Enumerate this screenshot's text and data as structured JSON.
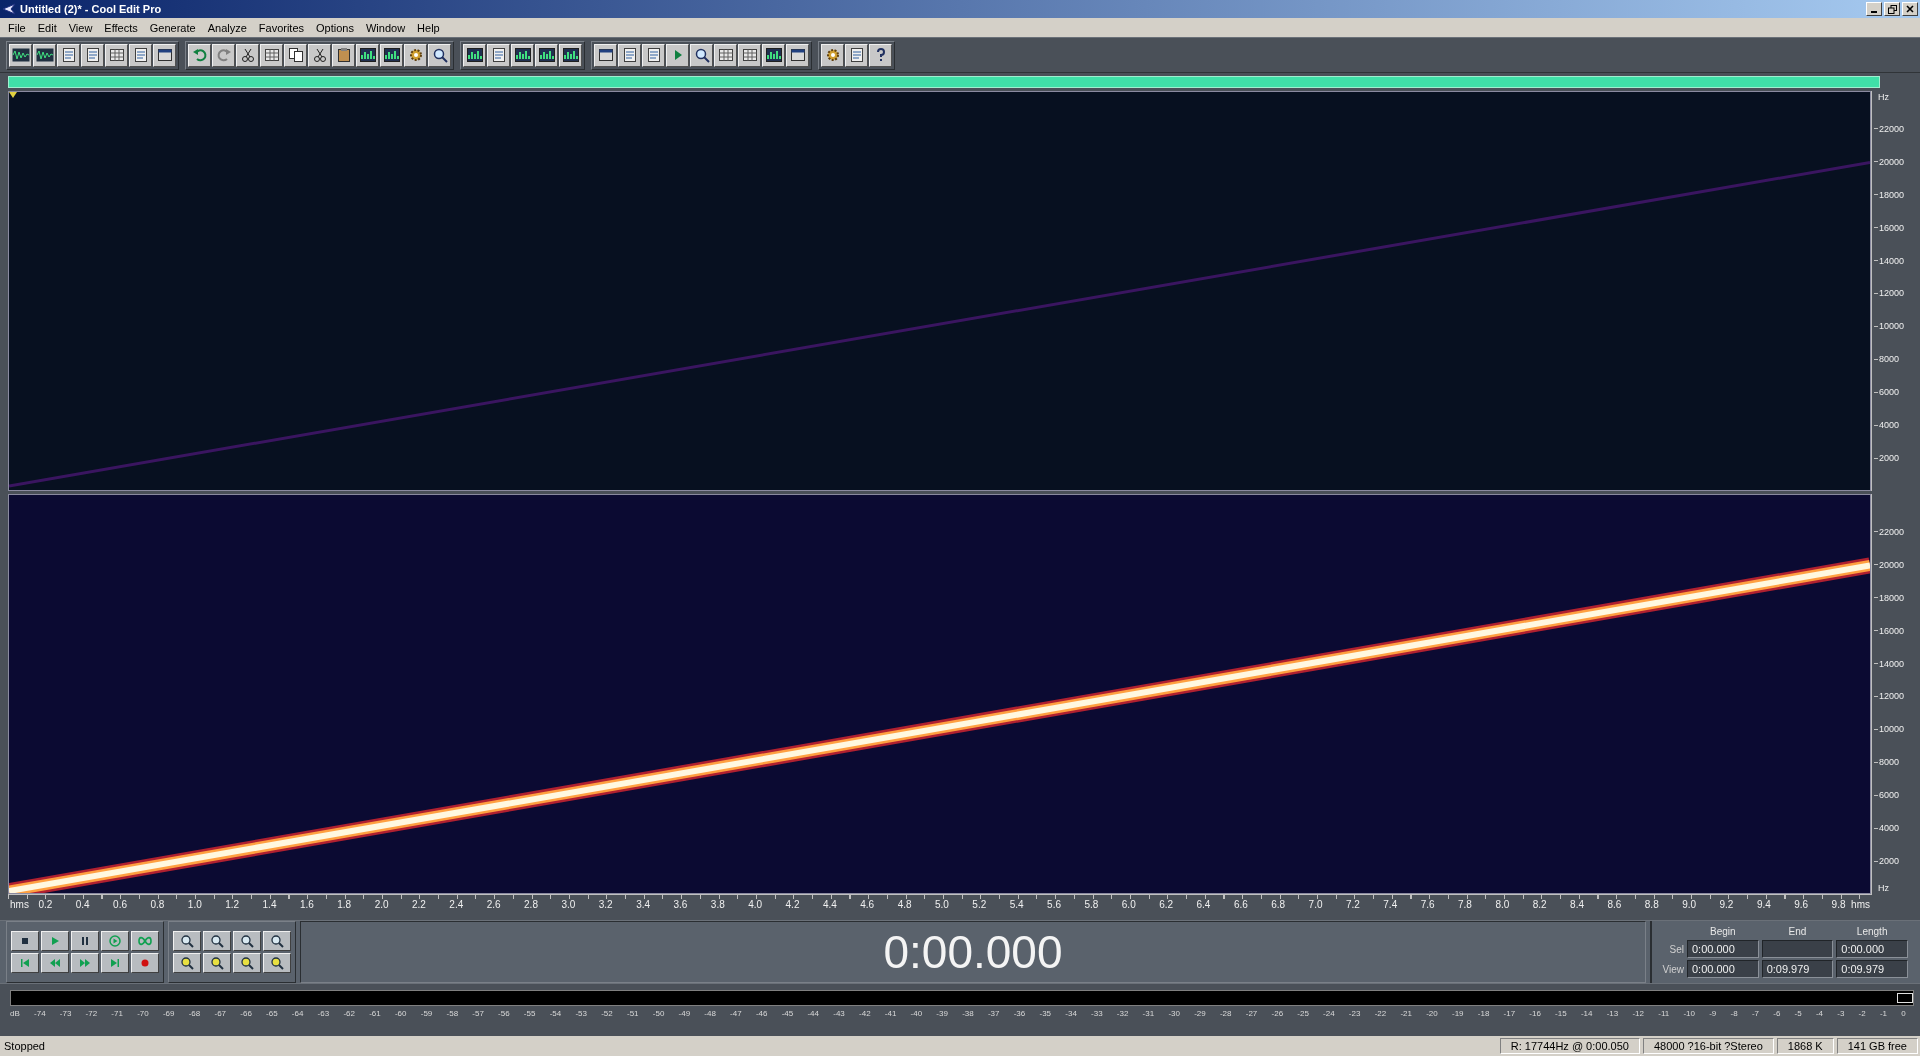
{
  "window": {
    "title": "Untitled (2)* - Cool Edit Pro"
  },
  "menu": [
    "File",
    "Edit",
    "View",
    "Effects",
    "Generate",
    "Analyze",
    "Favorites",
    "Options",
    "Window",
    "Help"
  ],
  "spectrogram": {
    "channels": [
      {
        "kind": "top",
        "unit": "Hz",
        "ticks": [
          "22000",
          "20000",
          "18000",
          "16000",
          "14000",
          "12000",
          "10000",
          "8000",
          "6000",
          "4000",
          "2000"
        ]
      },
      {
        "kind": "bottom",
        "unit": "Hz",
        "ticks": [
          "22000",
          "20000",
          "18000",
          "16000",
          "14000",
          "12000",
          "10000",
          "8000",
          "6000",
          "4000",
          "2000"
        ]
      }
    ]
  },
  "time_ruler": {
    "unit_start": "hms",
    "ticks": [
      "0.2",
      "0.4",
      "0.6",
      "0.8",
      "1.0",
      "1.2",
      "1.4",
      "1.6",
      "1.8",
      "2.0",
      "2.2",
      "2.4",
      "2.6",
      "2.8",
      "3.0",
      "3.2",
      "3.4",
      "3.6",
      "3.8",
      "4.0",
      "4.2",
      "4.4",
      "4.6",
      "4.8",
      "5.0",
      "5.2",
      "5.4",
      "5.6",
      "5.8",
      "6.0",
      "6.2",
      "6.4",
      "6.6",
      "6.8",
      "7.0",
      "7.2",
      "7.4",
      "7.6",
      "7.8",
      "8.0",
      "8.2",
      "8.4",
      "8.6",
      "8.8",
      "9.0",
      "9.2",
      "9.4",
      "9.6",
      "9.8"
    ],
    "unit_end": "hms"
  },
  "time_display": "0:00.000",
  "selection": {
    "columns": [
      "Begin",
      "End",
      "Length"
    ],
    "rows": [
      {
        "label": "Sel",
        "begin": "0:00.000",
        "length": "0:00.000"
      },
      {
        "label": "View",
        "begin": "0:00.000",
        "end": "0:09.979",
        "length": "0:09.979"
      }
    ]
  },
  "level_meter": {
    "unit": "dB",
    "ticks": [
      "-74",
      "-73",
      "-72",
      "-71",
      "-70",
      "-69",
      "-68",
      "-67",
      "-66",
      "-65",
      "-64",
      "-63",
      "-62",
      "-61",
      "-60",
      "-59",
      "-58",
      "-57",
      "-56",
      "-55",
      "-54",
      "-53",
      "-52",
      "-51",
      "-50",
      "-49",
      "-48",
      "-47",
      "-46",
      "-45",
      "-44",
      "-43",
      "-42",
      "-41",
      "-40",
      "-39",
      "-38",
      "-37",
      "-36",
      "-35",
      "-34",
      "-33",
      "-32",
      "-31",
      "-30",
      "-29",
      "-28",
      "-27",
      "-26",
      "-25",
      "-24",
      "-23",
      "-22",
      "-21",
      "-20",
      "-19",
      "-18",
      "-17",
      "-16",
      "-15",
      "-14",
      "-13",
      "-12",
      "-11",
      "-10",
      "-9",
      "-8",
      "-7",
      "-6",
      "-5",
      "-4",
      "-3",
      "-2",
      "-1",
      "0"
    ]
  },
  "status_bar": {
    "state": "Stopped",
    "cells": [
      "R: 17744Hz @  0:00.050",
      "48000 ?16-bit ?Stereo",
      "1868 K",
      "141 GB free"
    ]
  }
}
